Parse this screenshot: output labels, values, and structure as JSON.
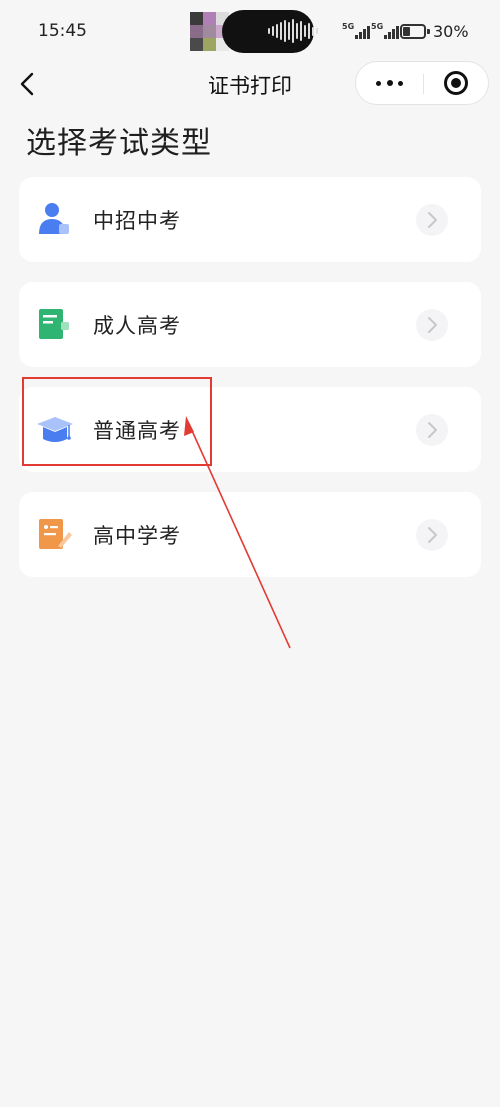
{
  "status_bar": {
    "time": "15:45",
    "network_label": "5G",
    "battery_text": "30%",
    "battery_level": 0.3
  },
  "nav": {
    "title": "证书打印",
    "back_icon": "chevron-left-icon",
    "more_icon": "more-dots-icon",
    "close_icon": "target-close-icon"
  },
  "page": {
    "title": "选择考试类型"
  },
  "exam_types": [
    {
      "label": "中招中考",
      "icon": "person-icon",
      "color": "#4a7df0"
    },
    {
      "label": "成人高考",
      "icon": "book-icon",
      "color": "#2fb472"
    },
    {
      "label": "普通高考",
      "icon": "graduation-cap-icon",
      "color": "#4a7df0"
    },
    {
      "label": "高中学考",
      "icon": "note-edit-icon",
      "color": "#f0974a"
    }
  ],
  "annotation": {
    "color": "#e23b33",
    "highlighted_item": "普通高考"
  }
}
